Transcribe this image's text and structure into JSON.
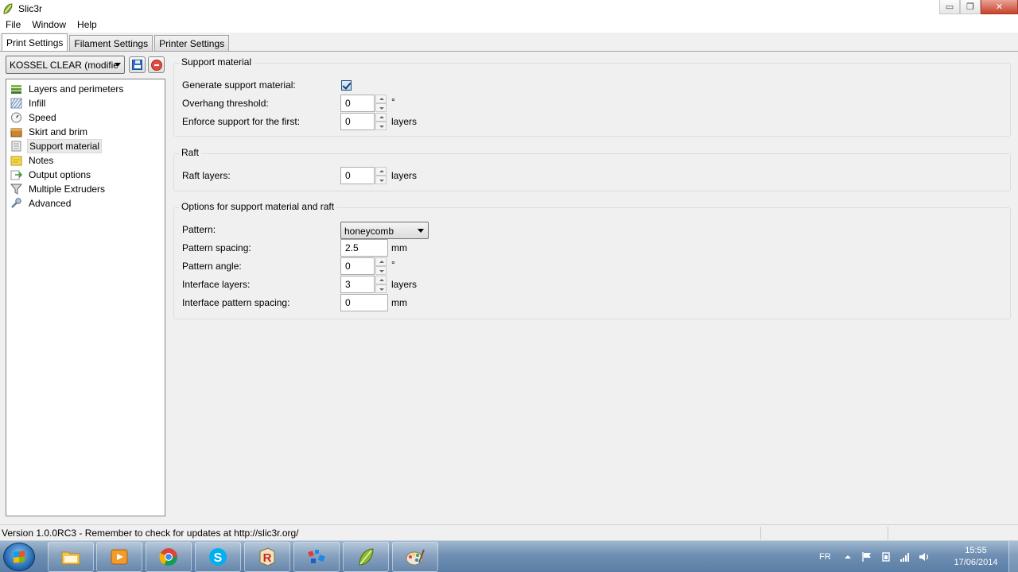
{
  "window": {
    "title": "Slic3r",
    "minimize_glyph": "▭",
    "restore_glyph": "❐",
    "close_glyph": "✕"
  },
  "menu": [
    "File",
    "Window",
    "Help"
  ],
  "tabs": [
    {
      "label": "Print Settings",
      "active": true
    },
    {
      "label": "Filament Settings",
      "active": false
    },
    {
      "label": "Printer Settings",
      "active": false
    }
  ],
  "preset": {
    "selected": "KOSSEL CLEAR (modifie"
  },
  "tree": [
    {
      "label": "Layers and perimeters",
      "icon": "layers-icon"
    },
    {
      "label": "Infill",
      "icon": "infill-icon"
    },
    {
      "label": "Speed",
      "icon": "speed-icon"
    },
    {
      "label": "Skirt and brim",
      "icon": "box-icon"
    },
    {
      "label": "Support material",
      "icon": "support-icon"
    },
    {
      "label": "Notes",
      "icon": "note-icon"
    },
    {
      "label": "Output options",
      "icon": "output-icon"
    },
    {
      "label": "Multiple Extruders",
      "icon": "funnel-icon"
    },
    {
      "label": "Advanced",
      "icon": "wrench-icon"
    }
  ],
  "support": {
    "title": "Support material",
    "generate_label": "Generate support material:",
    "generate_checked": true,
    "overhang_label": "Overhang threshold:",
    "overhang_value": "0",
    "overhang_unit": "°",
    "enforce_label": "Enforce support for the first:",
    "enforce_value": "0",
    "enforce_unit": "layers"
  },
  "raft": {
    "title": "Raft",
    "layers_label": "Raft layers:",
    "layers_value": "0",
    "layers_unit": "layers"
  },
  "options": {
    "title": "Options for support material and raft",
    "pattern_label": "Pattern:",
    "pattern_value": "honeycomb",
    "spacing_label": "Pattern spacing:",
    "spacing_value": "2.5",
    "spacing_unit": "mm",
    "angle_label": "Pattern angle:",
    "angle_value": "0",
    "angle_unit": "°",
    "interface_label": "Interface layers:",
    "interface_value": "3",
    "interface_unit": "layers",
    "interface_spacing_label": "Interface pattern spacing:",
    "interface_spacing_value": "0",
    "interface_spacing_unit": "mm"
  },
  "status": "Version 1.0.0RC3 - Remember to check for updates at http://slic3r.org/",
  "taskbar": {
    "apps": [
      "file-explorer-icon",
      "media-player-icon",
      "chrome-icon",
      "skype-icon",
      "repetier-icon",
      "stack-icon",
      "slic3r-icon",
      "paint-icon"
    ],
    "language": "FR",
    "time": "15:55",
    "date": "17/06/2014"
  }
}
